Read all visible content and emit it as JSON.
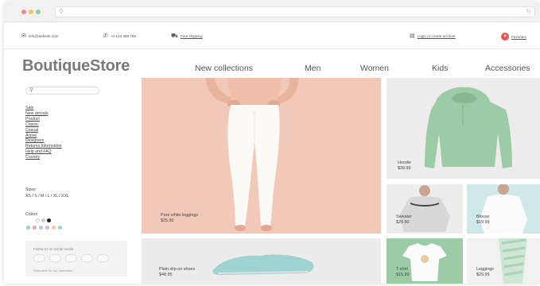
{
  "colors": {
    "accent_heart": "#e9554f",
    "hero_bg": "#f2c9b8",
    "sneaker": "#9fd3d2",
    "hoodie": "#9ccca5"
  },
  "browser": {
    "search_icon": "search-icon",
    "reload_icon": "reload-icon"
  },
  "utility": {
    "email": "info@website.com",
    "phone": "+0 123 456 789",
    "shipping": "Free shipping",
    "login": "Login or create account",
    "favorites": "Favorites"
  },
  "header": {
    "logo": "BoutiqueStore",
    "nav": [
      "New collections",
      "Men",
      "Women",
      "Kids",
      "Accessories"
    ]
  },
  "sidebar": {
    "categories": [
      "Sale",
      "New arrivals",
      "Product",
      "Classic",
      "Casual",
      "Active",
      "Designers",
      "Returns Information",
      "Help and FAQ",
      "Country"
    ],
    "sizes_label": "Sizes",
    "sizes": "XS / S / M / L / XL / XXL",
    "colors_label": "Colors",
    "swatches": [
      "#ffffff",
      "#cccccc",
      "#222222",
      "#9fd3a8",
      "#e7a3b3",
      "#a8c7e6",
      "#d3b8e8",
      "#f3c89a",
      "#9fd3d2"
    ],
    "social_title": "Follow us on social media",
    "social_footer": "Subscribe for our newsletter"
  },
  "products": {
    "hero": {
      "name": "Pure white leggings",
      "price": "$25.90"
    },
    "hoodie": {
      "name": "Hoodie",
      "price": "$39.99"
    },
    "sweater": {
      "name": "Sweater",
      "price": "$29.90"
    },
    "blouse": {
      "name": "Blouse",
      "price": "$19.99"
    },
    "shoes": {
      "name": "Plain slip-on shoes",
      "price": "$48.95"
    },
    "tshirt": {
      "name": "T-shirt",
      "price": "$15.99"
    },
    "leggings": {
      "name": "Leggings",
      "price": "$29.99"
    }
  }
}
